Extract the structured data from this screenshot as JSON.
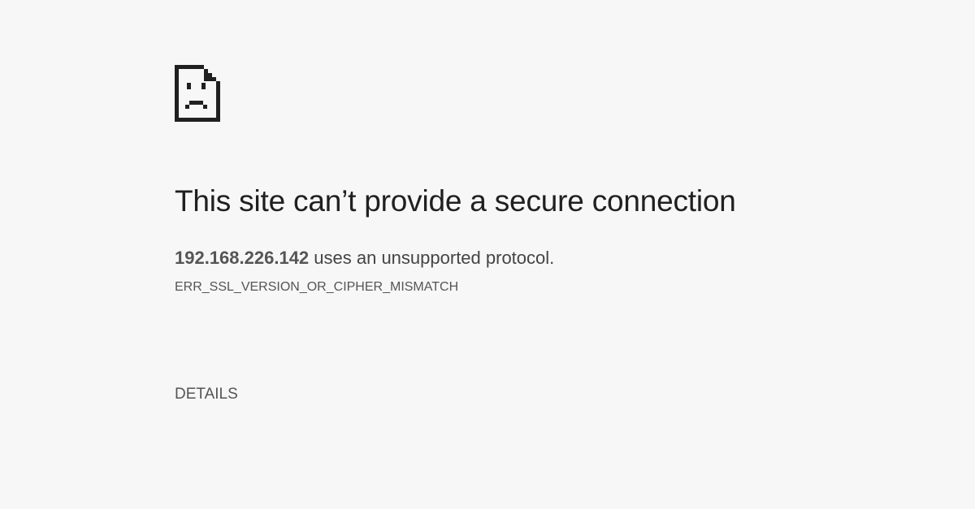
{
  "page": {
    "background_color": "#f7f7f7"
  },
  "icon": {
    "name": "sad-page-icon"
  },
  "error": {
    "title": "This site can’t provide a secure connection",
    "host": "192.168.226.142",
    "summary_suffix": " uses an unsupported protocol.",
    "code": "ERR_SSL_VERSION_OR_CIPHER_MISMATCH"
  },
  "actions": {
    "details_label": "DETAILS"
  }
}
